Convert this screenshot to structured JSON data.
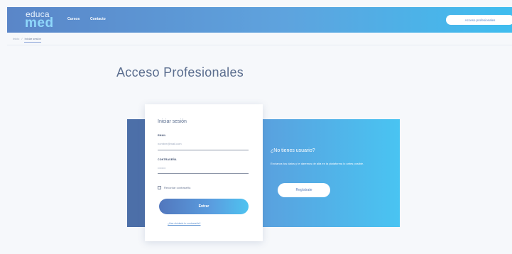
{
  "header": {
    "logo_top": "educa",
    "logo_bottom": "med",
    "nav": [
      {
        "label": "Cursos"
      },
      {
        "label": "Contacto"
      }
    ],
    "access_button": "Acceso profesionales"
  },
  "breadcrumb": {
    "home": "Inicio",
    "separator": "/",
    "current": "Iniciar sesión"
  },
  "page": {
    "title": "Acceso Profesionales"
  },
  "login": {
    "title": "Iniciar sesión",
    "email_label": "EMAIL",
    "email_placeholder": "nombre@mail.com",
    "password_label": "CONTRASEÑA",
    "password_placeholder": "••••••••",
    "remember_label": "Recordar contraseña",
    "submit_label": "Entrar",
    "forgot_label": "¿Has olvidado tu contraseña?"
  },
  "signup": {
    "question": "¿No tienes usuario?",
    "description": "Envíanos tus datos y te daremos de alta en la plataforma lo antes posible.",
    "button_label": "Regístrate"
  },
  "colors": {
    "accent": "#5a86c8",
    "brand_light": "#8fd8fb",
    "panel_dark": "#4c6fa8",
    "panel_gradient_end": "#49c4f2"
  }
}
